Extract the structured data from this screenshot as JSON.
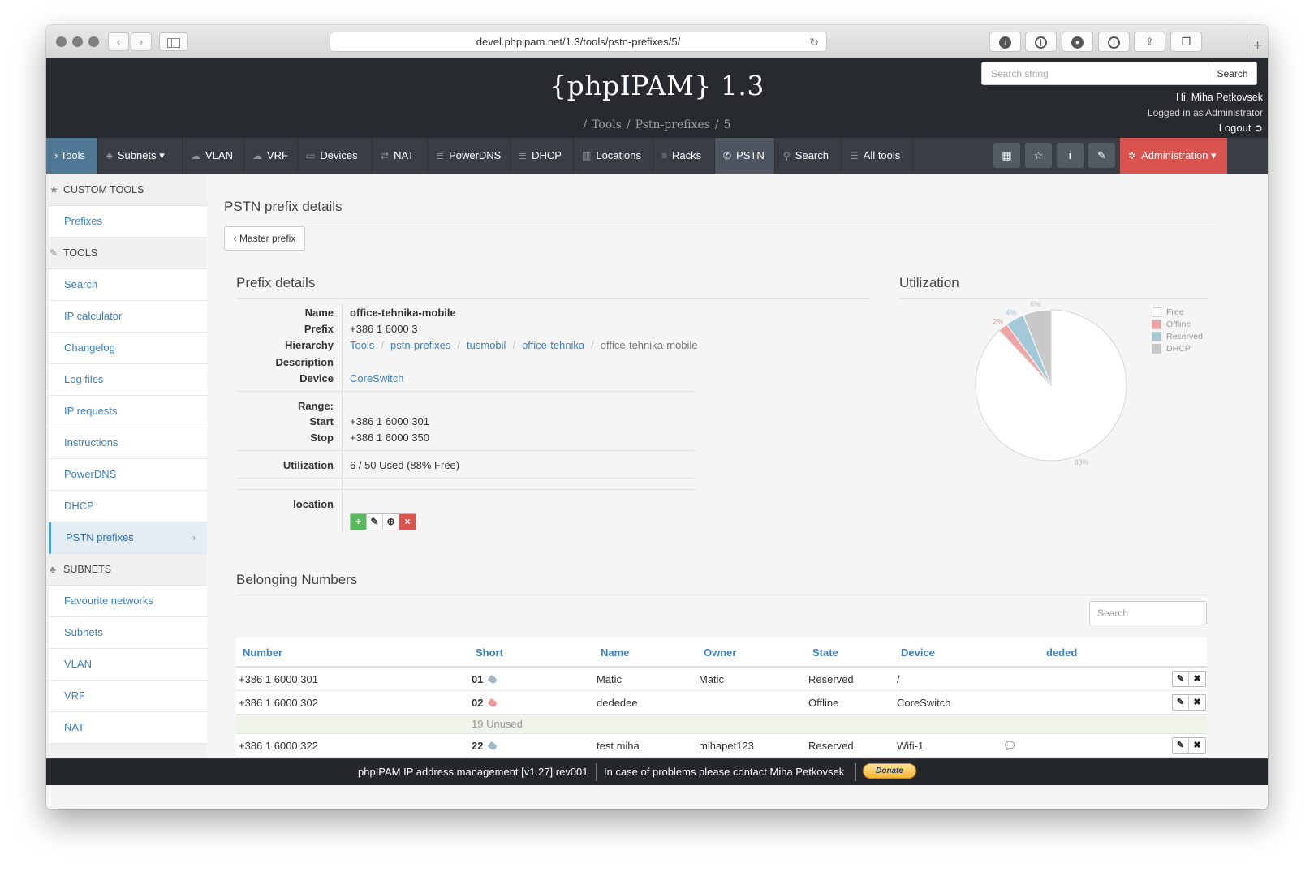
{
  "browser": {
    "url": "devel.phpipam.net/1.3/tools/pstn-prefixes/5/",
    "back_glyph": "‹",
    "forward_glyph": "›"
  },
  "header": {
    "brand": "{phpIPAM} 1.3",
    "breadcrumb": [
      "/",
      "Tools",
      "/",
      "Pstn-prefixes",
      "/",
      "5"
    ],
    "search_placeholder": "Search string",
    "search_button": "Search",
    "greeting": "Hi, Miha Petkovsek",
    "role": "Logged in as Administrator",
    "logout": "Logout"
  },
  "menu": {
    "tools": "› Tools",
    "subnets": "Subnets ▾",
    "vlan": "VLAN",
    "vrf": "VRF",
    "devices": "Devices",
    "nat": "NAT",
    "powerdns": "PowerDNS",
    "dhcp": "DHCP",
    "locations": "Locations",
    "racks": "Racks",
    "pstn": "PSTN",
    "search": "Search",
    "all_tools": "All tools",
    "administration": "Administration ▾"
  },
  "sidebar": {
    "custom_tools_heading": "CUSTOM TOOLS",
    "custom_tools": [
      "Prefixes"
    ],
    "tools_heading": "TOOLS",
    "tools": [
      "Search",
      "IP calculator",
      "Changelog",
      "Log files",
      "IP requests",
      "Instructions",
      "PowerDNS",
      "DHCP",
      "PSTN prefixes"
    ],
    "subnets_heading": "SUBNETS",
    "subnets": [
      "Favourite networks",
      "Subnets",
      "VLAN",
      "VRF",
      "NAT"
    ]
  },
  "page": {
    "title": "PSTN prefix details",
    "master_button": "‹ Master prefix"
  },
  "details": {
    "heading": "Prefix details",
    "labels": {
      "name": "Name",
      "prefix": "Prefix",
      "hierarchy": "Hierarchy",
      "description": "Description",
      "device": "Device",
      "range": "Range:",
      "start": "Start",
      "stop": "Stop",
      "utilization": "Utilization",
      "location": "location"
    },
    "name": "office-tehnika-mobile",
    "prefix": "+386 1 6000 3",
    "hierarchy": [
      "Tools",
      "pstn-prefixes",
      "tusmobil",
      "office-tehnika",
      "office-tehnika-mobile"
    ],
    "hierarchy_sep": "/",
    "device": "CoreSwitch",
    "start": "+386 1 6000 301",
    "stop": "+386 1 6000 350",
    "utilization": "6 / 50 Used (88% Free)"
  },
  "utilization": {
    "heading": "Utilization",
    "legend": [
      {
        "label": "Free",
        "color": "#ffffff"
      },
      {
        "label": "Offline",
        "color": "#f1a3a3"
      },
      {
        "label": "Reserved",
        "color": "#a3c9d9"
      },
      {
        "label": "DHCP",
        "color": "#c8c8c8"
      }
    ]
  },
  "chart_data": {
    "type": "pie",
    "categories": [
      "Free",
      "Offline",
      "Reserved",
      "DHCP"
    ],
    "values": [
      88,
      2,
      4,
      6
    ],
    "colors": [
      "#ffffff",
      "#f1a3a3",
      "#a3c9d9",
      "#c8c8c8"
    ],
    "data_labels": [
      "88%",
      "2%",
      "4%",
      "6%"
    ],
    "legend_position": "top-right"
  },
  "numbers": {
    "heading": "Belonging Numbers",
    "search_placeholder": "Search",
    "columns": [
      "Number",
      "Short",
      "Name",
      "Owner",
      "State",
      "Device",
      "deded"
    ],
    "rows": [
      {
        "number": "+386 1 6000 301",
        "short": "01",
        "tag": "reserved",
        "name": "Matic",
        "owner": "Matic",
        "state": "Reserved",
        "device": "/",
        "device_link": false,
        "comment": false
      },
      {
        "number": "+386 1 6000 302",
        "short": "02",
        "tag": "offline",
        "name": "dededee",
        "owner": "",
        "state": "Offline",
        "device": "CoreSwitch",
        "device_link": true,
        "comment": false
      },
      {
        "unused": "19 Unused"
      },
      {
        "number": "+386 1 6000 322",
        "short": "22",
        "tag": "reserved",
        "name": "test miha",
        "owner": "mihapet123",
        "state": "Reserved",
        "device": "Wifi-1",
        "device_link": true,
        "comment": true
      }
    ]
  },
  "footer": {
    "left": "phpIPAM IP address management [v1.27] rev001",
    "right": "In case of problems please contact Miha Petkovsek",
    "donate": "Donate"
  }
}
